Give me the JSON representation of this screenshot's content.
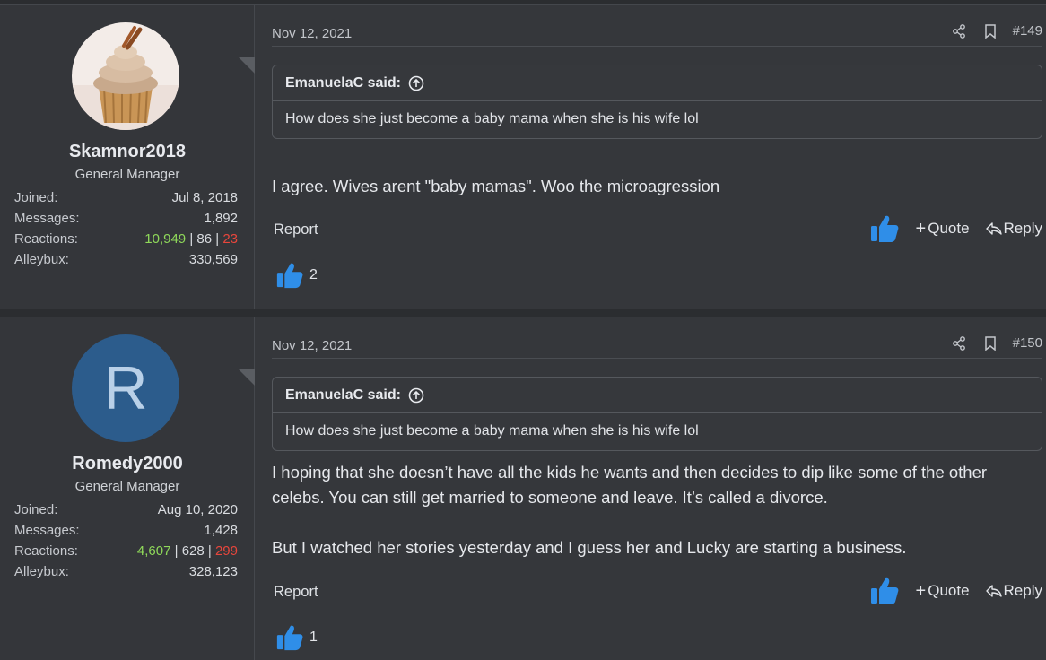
{
  "posts": [
    {
      "user": {
        "username": "Skamnor2018",
        "title": "General Manager",
        "avatar": "cupcake-photo",
        "joined_label": "Joined:",
        "joined": "Jul 8, 2018",
        "messages_label": "Messages:",
        "messages": "1,892",
        "reactions_label": "Reactions:",
        "reactions_pos": "10,949",
        "reactions_neu": "86",
        "reactions_neg": "23",
        "alleybux_label": "Alleybux:",
        "alleybux": "330,569"
      },
      "date": "Nov 12, 2021",
      "number": "#149",
      "quote": {
        "author": "EmanuelaC said:",
        "text": "How does she just become a baby mama when she is his wife lol"
      },
      "body": [
        "I agree. Wives arent \"baby mamas\". Woo the microagression"
      ],
      "report": "Report",
      "quote_label": "Quote",
      "reply_label": "Reply",
      "reaction_count": "2"
    },
    {
      "user": {
        "username": "Romedy2000",
        "title": "General Manager",
        "avatar_letter": "R",
        "joined_label": "Joined:",
        "joined": "Aug 10, 2020",
        "messages_label": "Messages:",
        "messages": "1,428",
        "reactions_label": "Reactions:",
        "reactions_pos": "4,607",
        "reactions_neu": "628",
        "reactions_neg": "299",
        "alleybux_label": "Alleybux:",
        "alleybux": "328,123"
      },
      "date": "Nov 12, 2021",
      "number": "#150",
      "quote": {
        "author": "EmanuelaC said:",
        "text": "How does she just become a baby mama when she is his wife lol"
      },
      "body": [
        "I hoping that she doesn’t have all the kids he wants and then decides to dip like some of the other celebs. You can still get married to someone and leave. It’s called a divorce.",
        "But I watched her stories yesterday and I guess her and Lucky are starting a business."
      ],
      "report": "Report",
      "quote_label": "Quote",
      "reply_label": "Reply",
      "reaction_count": "1"
    }
  ],
  "colors": {
    "like_blue": "#2f8ee8",
    "positive": "#8fd95a",
    "negative": "#e8463c",
    "avatar_bg": "#2c5c8c"
  }
}
